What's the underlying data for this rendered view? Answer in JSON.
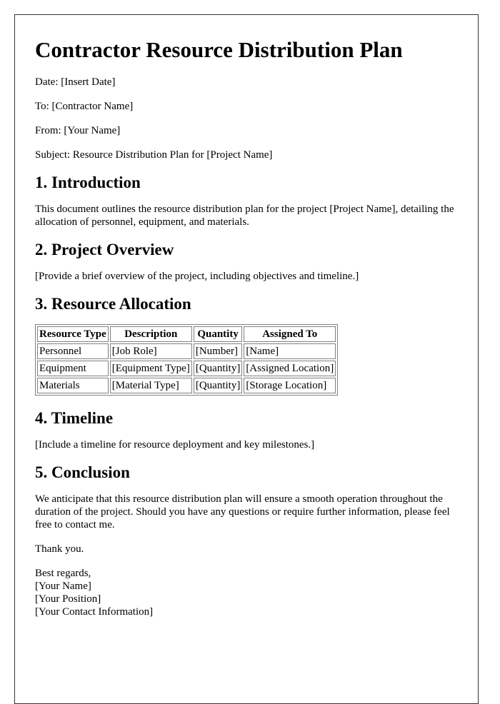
{
  "title": "Contractor Resource Distribution Plan",
  "meta": {
    "date": "Date: [Insert Date]",
    "to": "To: [Contractor Name]",
    "from": "From: [Your Name]",
    "subject": "Subject: Resource Distribution Plan for [Project Name]"
  },
  "sections": {
    "introduction": {
      "heading": "1. Introduction",
      "body": "This document outlines the resource distribution plan for the project [Project Name], detailing the allocation of personnel, equipment, and materials."
    },
    "overview": {
      "heading": "2. Project Overview",
      "body": "[Provide a brief overview of the project, including objectives and timeline.]"
    },
    "allocation": {
      "heading": "3. Resource Allocation",
      "table": {
        "headers": [
          "Resource Type",
          "Description",
          "Quantity",
          "Assigned To"
        ],
        "rows": [
          [
            "Personnel",
            "[Job Role]",
            "[Number]",
            "[Name]"
          ],
          [
            "Equipment",
            "[Equipment Type]",
            "[Quantity]",
            "[Assigned Location]"
          ],
          [
            "Materials",
            "[Material Type]",
            "[Quantity]",
            "[Storage Location]"
          ]
        ]
      }
    },
    "timeline": {
      "heading": "4. Timeline",
      "body": "[Include a timeline for resource deployment and key milestones.]"
    },
    "conclusion": {
      "heading": "5. Conclusion",
      "body": "We anticipate that this resource distribution plan will ensure a smooth operation throughout the duration of the project. Should you have any questions or require further information, please feel free to contact me."
    }
  },
  "closing": {
    "thanks": "Thank you.",
    "signoff": "Best regards,",
    "name": "[Your Name]",
    "position": "[Your Position]",
    "contact": "[Your Contact Information]"
  }
}
